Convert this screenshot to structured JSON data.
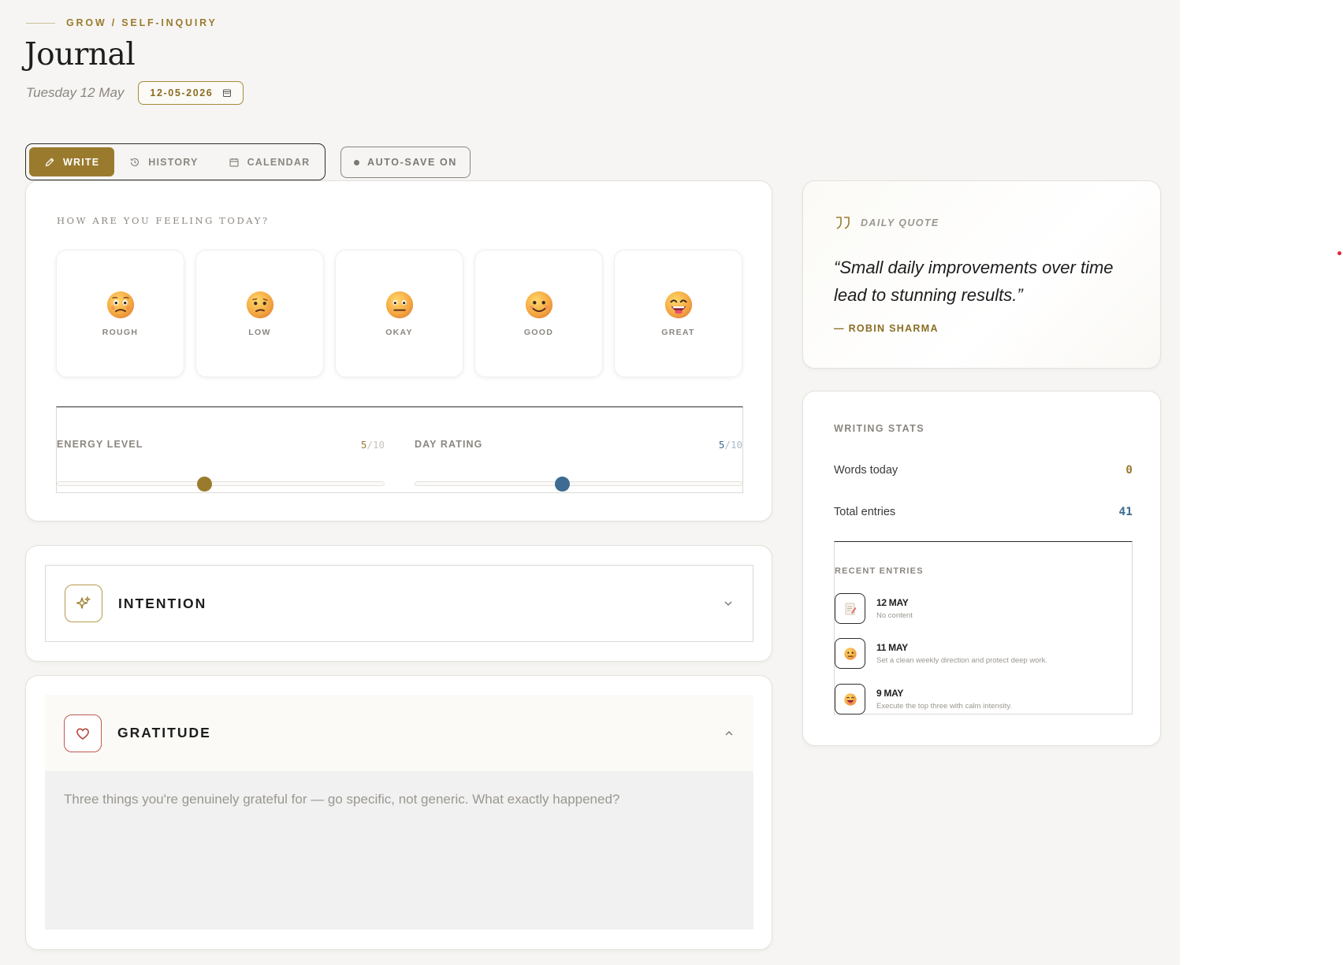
{
  "header": {
    "breadcrumb": "GROW / SELF-INQUIRY",
    "title": "Journal",
    "date_text": "Tuesday 12 May",
    "date_picker_value": "12-05-2026"
  },
  "tabs": [
    {
      "label": "WRITE",
      "icon": "pencil-icon",
      "active": true
    },
    {
      "label": "HISTORY",
      "icon": "history-icon",
      "active": false
    },
    {
      "label": "CALENDAR",
      "icon": "calendar-icon",
      "active": false
    }
  ],
  "autosave": {
    "label": "AUTO-SAVE ON"
  },
  "feeling": {
    "question": "HOW ARE YOU FEELING TODAY?",
    "moods": [
      {
        "label": "ROUGH",
        "icon": "anxious-face-icon"
      },
      {
        "label": "LOW",
        "icon": "confused-face-icon"
      },
      {
        "label": "OKAY",
        "icon": "neutral-face-icon"
      },
      {
        "label": "GOOD",
        "icon": "smiling-face-icon"
      },
      {
        "label": "GREAT",
        "icon": "grinning-face-icon"
      }
    ]
  },
  "sliders": {
    "energy": {
      "label": "ENERGY LEVEL",
      "value": "5",
      "max": "/10",
      "level": 0.45,
      "color": "#9a7b2e"
    },
    "day_rating": {
      "label": "DAY RATING",
      "value": "5",
      "max": "/10",
      "level": 0.45,
      "color": "#3d6b92"
    }
  },
  "intention": {
    "title": "INTENTION",
    "icon": "sparkle-icon",
    "expanded": false
  },
  "gratitude": {
    "title": "GRATITUDE",
    "icon": "heart-icon",
    "expanded": true,
    "placeholder": "Three things you're genuinely grateful for — go specific, not generic. What exactly happened?"
  },
  "quote": {
    "label": "DAILY QUOTE",
    "text": "“Small daily improvements over time lead to stunning results.”",
    "author": "— ROBIN SHARMA"
  },
  "stats": {
    "label": "WRITING STATS",
    "words_today_label": "Words today",
    "words_today": "0",
    "total_entries_label": "Total entries",
    "total_entries": "41",
    "recent_label": "RECENT ENTRIES",
    "recent": [
      {
        "date": "12 MAY",
        "desc": "No content",
        "icon": "memo-icon"
      },
      {
        "date": "11 MAY",
        "desc": "Set a clean weekly direction and protect deep work.",
        "icon": "neutral-face-icon"
      },
      {
        "date": "9 MAY",
        "desc": "Execute the top three with calm intensity.",
        "icon": "grinning-face-icon"
      }
    ]
  },
  "colors": {
    "accent": "#9a7b2e",
    "blue": "#3d6b92",
    "heart": "#b8473e"
  }
}
